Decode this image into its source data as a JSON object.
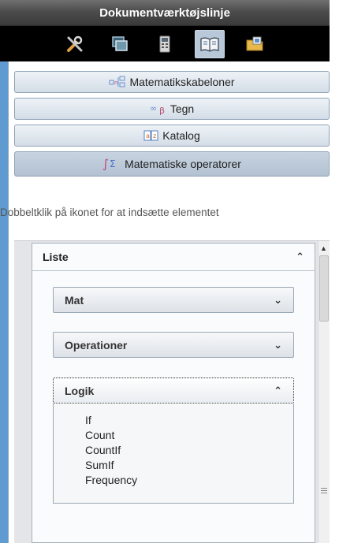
{
  "titlebar": {
    "title": "Dokumentværktøjslinje"
  },
  "toolbar": {
    "buttons": [
      {
        "icon": "tools-icon",
        "active": false
      },
      {
        "icon": "page-sorter-icon",
        "active": false
      },
      {
        "icon": "calculator-icon",
        "active": false
      },
      {
        "icon": "utilities-book-icon",
        "active": true
      },
      {
        "icon": "content-explorer-icon",
        "active": false
      }
    ]
  },
  "sections": [
    {
      "label": "Matematikskabeloner",
      "icon": "math-templates-icon",
      "selected": false
    },
    {
      "label": "Tegn",
      "icon": "symbols-icon",
      "selected": false
    },
    {
      "label": "Katalog",
      "icon": "catalog-icon",
      "selected": false
    },
    {
      "label": "Matematiske operatorer",
      "icon": "math-operators-icon",
      "selected": true
    }
  ],
  "hint": "Dobbeltklik på ikonet for at indsætte elementet",
  "liste": {
    "label": "Liste",
    "chevron": "⌃"
  },
  "subsections": [
    {
      "label": "Mat",
      "chevron": "⌄"
    },
    {
      "label": "Operationer",
      "chevron": "⌄"
    },
    {
      "label": "Logik",
      "chevron": "⌃"
    }
  ],
  "logik_items": [
    "If",
    "Count",
    "CountIf",
    "SumIf",
    "Frequency"
  ],
  "colors": {
    "accent_strip": "#5f9bd1",
    "selected_tab": "#b9c8d9"
  }
}
